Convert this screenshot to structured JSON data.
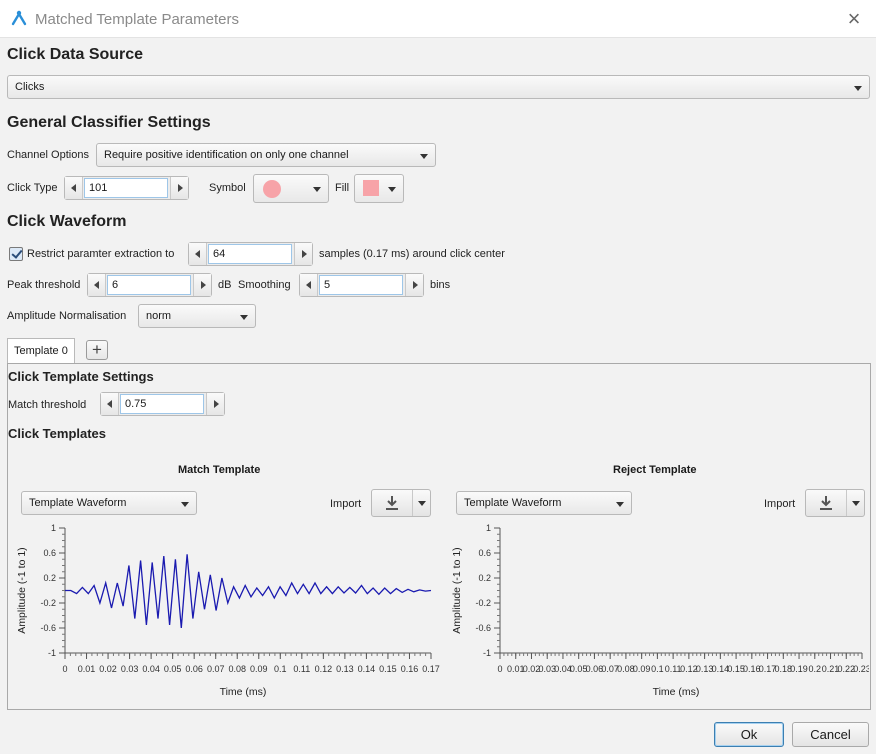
{
  "window": {
    "title": "Matched Template Parameters"
  },
  "data_source": {
    "heading": "Click Data Source",
    "selected": "Clicks"
  },
  "general": {
    "heading": "General Classifier Settings",
    "channel_label": "Channel Options",
    "channel_value": "Require positive identification on only one channel",
    "click_type_label": "Click Type",
    "click_type_value": "101",
    "symbol_label": "Symbol",
    "fill_label": "Fill",
    "symbol_color": "#f7a3a8",
    "fill_color": "#f7a3a8"
  },
  "waveform": {
    "heading": "Click Waveform",
    "restrict_label": "Restrict paramter extraction to",
    "restrict_checked": true,
    "samples_value": "64",
    "samples_suffix": "samples  (0.17 ms) around click center",
    "peak_label": "Peak threshold",
    "peak_value": "6",
    "peak_unit": "dB",
    "smoothing_label": "Smoothing",
    "smoothing_value": "5",
    "smoothing_unit": "bins",
    "amp_norm_label": "Amplitude Normalisation",
    "amp_norm_value": "norm"
  },
  "tabs": [
    {
      "label": "Template 0"
    }
  ],
  "template": {
    "settings_heading": "Click Template Settings",
    "match_threshold_label": "Match threshold",
    "match_threshold_value": "0.75",
    "templates_heading": "Click Templates",
    "import_label": "Import",
    "waveform_dropdown": "Template Waveform"
  },
  "buttons": {
    "ok": "Ok",
    "cancel": "Cancel"
  },
  "colors": {
    "accent": "#3c7fb1",
    "series": "#1a1ab0"
  },
  "chart_data": [
    {
      "type": "line",
      "title": "Match Template",
      "xlabel": "Time (ms)",
      "ylabel": "Amplitude (-1 to 1)",
      "xlim": [
        0,
        0.17
      ],
      "ylim": [
        -1,
        1
      ],
      "xticks": [
        "0",
        "0.01",
        "0.02",
        "0.03",
        "0.04",
        "0.05",
        "0.06",
        "0.07",
        "0.08",
        "0.09",
        "0.1",
        "0.11",
        "0.12",
        "0.13",
        "0.14",
        "0.15",
        "0.16",
        "0.17"
      ],
      "yticks": [
        "-1",
        "-0.6",
        "-0.2",
        "0.2",
        "0.6",
        "1"
      ],
      "grid": false,
      "series": [
        {
          "x": [
            0,
            0.0027,
            0.0054,
            0.0081,
            0.0108,
            0.0135,
            0.0162,
            0.0189,
            0.0216,
            0.0243,
            0.027,
            0.0297,
            0.0324,
            0.0351,
            0.0378,
            0.0405,
            0.0432,
            0.0459,
            0.0486,
            0.0513,
            0.054,
            0.0567,
            0.0594,
            0.0621,
            0.0648,
            0.0675,
            0.0702,
            0.0729,
            0.0756,
            0.0783,
            0.081,
            0.0837,
            0.0864,
            0.0891,
            0.0918,
            0.0945,
            0.0972,
            0.0999,
            0.1026,
            0.1053,
            0.108,
            0.1107,
            0.1134,
            0.1161,
            0.1188,
            0.1215,
            0.1242,
            0.1269,
            0.1296,
            0.1323,
            0.135,
            0.1377,
            0.1404,
            0.1431,
            0.1458,
            0.1485,
            0.1512,
            0.1539,
            0.1566,
            0.1593,
            0.162,
            0.1647,
            0.1674,
            0.17
          ],
          "y": [
            0.0,
            0.0,
            -0.05,
            0.05,
            -0.05,
            0.08,
            -0.2,
            0.12,
            -0.28,
            0.12,
            -0.25,
            0.4,
            -0.45,
            0.48,
            -0.55,
            0.45,
            -0.45,
            0.55,
            -0.55,
            0.5,
            -0.6,
            0.58,
            -0.45,
            0.3,
            -0.3,
            0.25,
            -0.32,
            0.2,
            -0.2,
            0.06,
            -0.12,
            0.08,
            -0.1,
            0.04,
            -0.08,
            0.06,
            -0.12,
            0.06,
            -0.08,
            0.12,
            -0.05,
            0.1,
            -0.05,
            0.12,
            -0.05,
            0.06,
            -0.05,
            0.06,
            -0.04,
            0.05,
            -0.04,
            0.08,
            -0.05,
            0.04,
            -0.06,
            0.04,
            -0.05,
            0.03,
            -0.03,
            0.02,
            -0.02,
            0.01,
            -0.01,
            0.0
          ]
        }
      ]
    },
    {
      "type": "line",
      "title": "Reject Template",
      "xlabel": "Time (ms)",
      "ylabel": "Amplitude (-1 to 1)",
      "xlim": [
        0,
        0.23
      ],
      "ylim": [
        -1,
        1
      ],
      "xticks": [
        "0",
        "0.01",
        "0.02",
        "0.03",
        "0.04",
        "0.05",
        "0.06",
        "0.07",
        "0.08",
        "0.09",
        "0.1",
        "0.11",
        "0.12",
        "0.13",
        "0.14",
        "0.15",
        "0.16",
        "0.17",
        "0.18",
        "0.19",
        "0.2",
        "0.21",
        "0.22",
        "0.23"
      ],
      "yticks": [
        "-1",
        "-0.6",
        "-0.2",
        "0.2",
        "0.6",
        "1"
      ],
      "grid": false,
      "series": []
    }
  ]
}
